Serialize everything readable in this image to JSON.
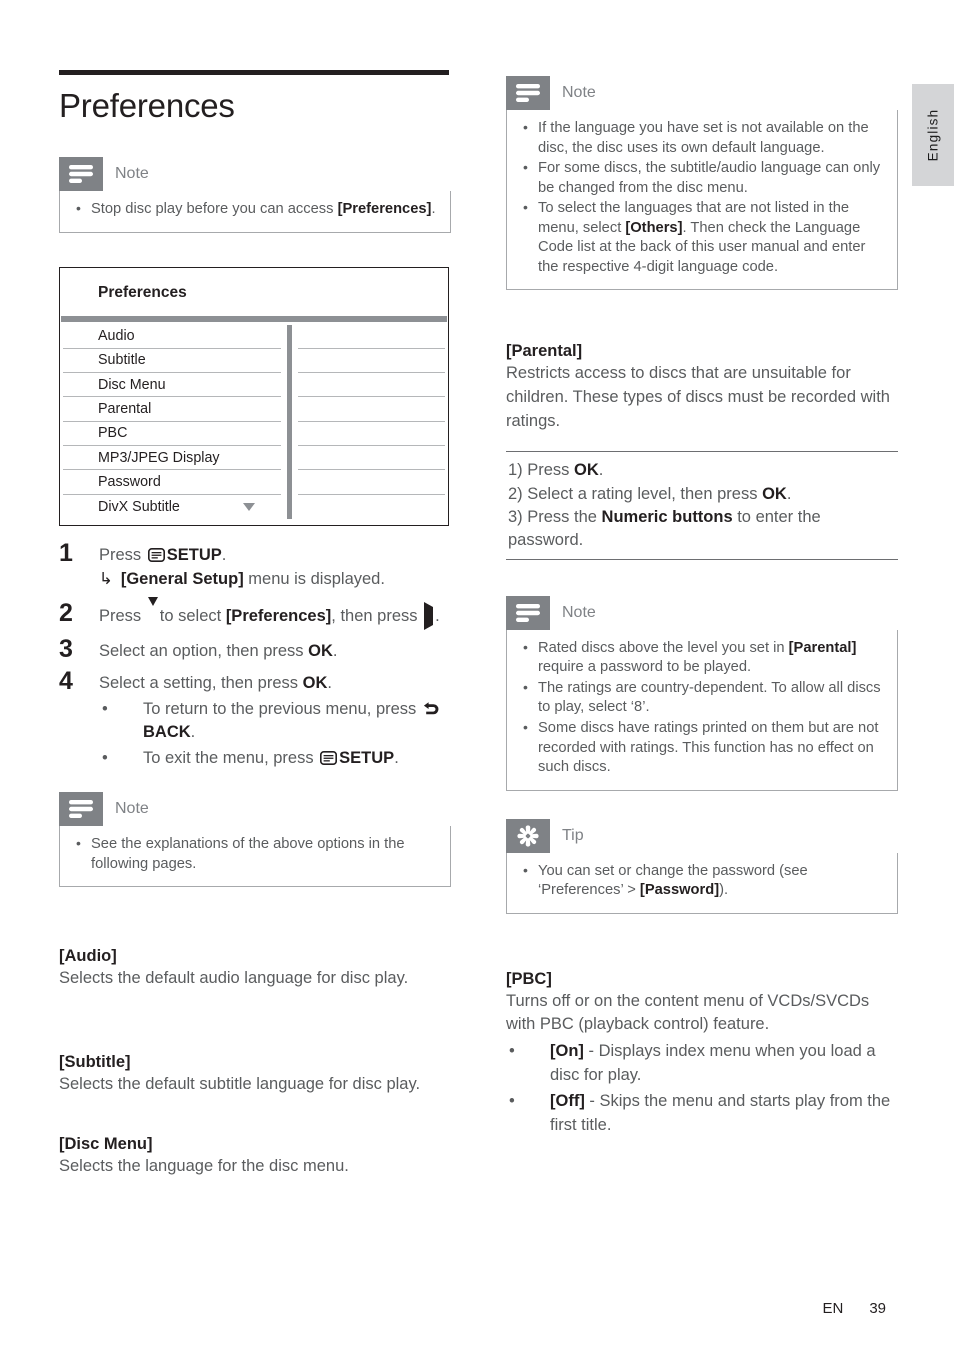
{
  "page": {
    "title": "Preferences",
    "language_tab": "English",
    "footer_locale": "EN",
    "footer_page_number": "39"
  },
  "colors": {
    "callout_badge": "#7f8286",
    "callout_label": "#7f8286",
    "body_text": "#5a5c5e",
    "heading_text": "#231f20",
    "rule_dark": "#231f20",
    "table_divider": "#8d9094",
    "lang_tab_bg": "#d4d5d7"
  },
  "left": {
    "note_top": {
      "label": "Note",
      "icon": "note-lines-icon",
      "items": [
        {
          "text_before": "Stop disc play before you can access ",
          "bold": "[Preferences]",
          "text_after": "."
        }
      ]
    },
    "pref_menu": {
      "title": "Preferences",
      "rows": [
        "Audio",
        "Subtitle",
        "Disc Menu",
        "Parental",
        "PBC",
        "MP3/JPEG Display",
        "Password",
        "DivX Subtitle"
      ],
      "scroll_caret_row": "DivX Subtitle",
      "caret_icon": "chevron-down-icon"
    },
    "steps": [
      {
        "num": "1",
        "line": [
          {
            "t": "Press "
          },
          {
            "icon": "setup-icon"
          },
          {
            "t": " "
          },
          {
            "b": "SETUP"
          },
          {
            "t": "."
          }
        ],
        "sub": [
          {
            "arrow": "↳",
            "b": "[General Setup]",
            "t": " menu is displayed."
          }
        ]
      },
      {
        "num": "2",
        "line": [
          {
            "t": "Press "
          },
          {
            "icon": "triangle-down-icon"
          },
          {
            "t": " to select "
          },
          {
            "b": "[Preferences]"
          },
          {
            "t": ", then press "
          },
          {
            "icon": "triangle-right-icon"
          },
          {
            "t": "."
          }
        ]
      },
      {
        "num": "3",
        "line": [
          {
            "t": "Select an option, then press "
          },
          {
            "b": "OK"
          },
          {
            "t": "."
          }
        ]
      },
      {
        "num": "4",
        "line": [
          {
            "t": "Select a setting, then press "
          },
          {
            "b": "OK"
          },
          {
            "t": "."
          }
        ],
        "bullets": [
          {
            "t1": "To return to the previous menu, press ",
            "icon": "back-icon",
            "b": "BACK",
            "t2": "."
          },
          {
            "t1": "To exit the menu, press ",
            "icon": "setup-icon",
            "b": "SETUP",
            "t2": "."
          }
        ]
      }
    ],
    "note_bottom": {
      "label": "Note",
      "icon": "note-lines-icon",
      "items": [
        {
          "text_before": "See the explanations of the above options in the following pages.",
          "bold": "",
          "text_after": ""
        }
      ]
    },
    "sections": [
      {
        "heading": "[Audio]",
        "body": "Selects the default audio language for disc play."
      },
      {
        "heading": "[Subtitle]",
        "body": "Selects the default subtitle language for disc play."
      },
      {
        "heading": "[Disc Menu]",
        "body": "Selects the language for the disc menu."
      }
    ]
  },
  "right": {
    "note_language": {
      "label": "Note",
      "icon": "note-lines-icon",
      "items": [
        {
          "text_before": "If the language you have set is not available on the disc, the disc uses its own default language.",
          "bold": "",
          "text_after": ""
        },
        {
          "text_before": "For some discs, the subtitle/audio language can only be changed from the disc menu.",
          "bold": "",
          "text_after": ""
        },
        {
          "text_before": "To select the languages that are not listed in the menu, select ",
          "bold": "[Others]",
          "text_after": ". Then check the Language Code list at the back of this user manual and enter the respective 4-digit language code."
        }
      ]
    },
    "parental": {
      "heading": "[Parental]",
      "body": "Restricts access to discs that are unsuitable for children. These types of discs must be recorded with ratings.",
      "procedure": [
        {
          "t1": "1) Press ",
          "b": "OK",
          "t2": "."
        },
        {
          "t1": "2) Select a rating level, then press ",
          "b": "OK",
          "t2": "."
        },
        {
          "t1": "3) Press the ",
          "b": "Numeric buttons",
          "t2": " to enter the password."
        }
      ]
    },
    "note_parental": {
      "label": "Note",
      "icon": "note-lines-icon",
      "items": [
        {
          "text_before": "Rated discs above the level you set in ",
          "bold": "[Parental]",
          "text_after": " require a password to be played."
        },
        {
          "text_before": "The ratings are country-dependent. To allow all discs to play, select ‘8’.",
          "bold": "",
          "text_after": ""
        },
        {
          "text_before": "Some discs have ratings printed on them but are not recorded with ratings. This function has no effect on such discs.",
          "bold": "",
          "text_after": ""
        }
      ]
    },
    "tip_password": {
      "label": "Tip",
      "icon": "tip-asterisk-icon",
      "items": [
        {
          "text_before": "You can set or change the password (see ‘Preferences’ > ",
          "bold": "[Password]",
          "text_after": ")."
        }
      ]
    },
    "pbc": {
      "heading": "[PBC]",
      "body": "Turns off or on the content menu of VCDs/SVCDs with PBC (playback control) feature.",
      "options": [
        {
          "bold": "[On]",
          "text": " - Displays index menu when you load a disc for play."
        },
        {
          "bold": "[Off]",
          "text": " - Skips the menu and starts play from the first title."
        }
      ]
    }
  }
}
